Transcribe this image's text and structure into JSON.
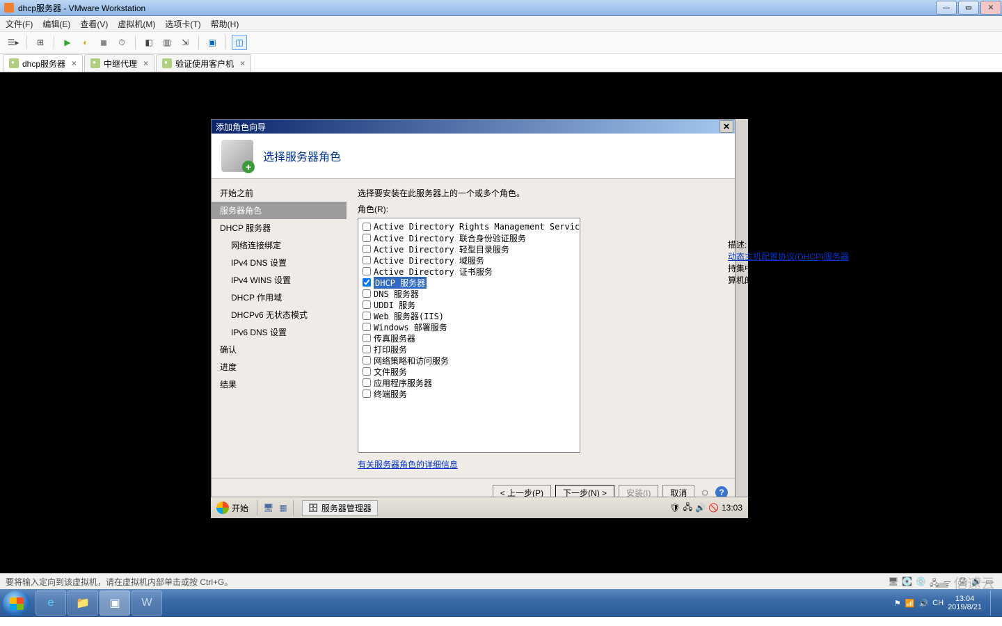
{
  "win7": {
    "title": "dhcp服务器 - VMware Workstation",
    "tray": {
      "time": "13:04",
      "date": "2019/8/21",
      "lang": "CH"
    }
  },
  "vmware": {
    "menu": [
      "文件(F)",
      "编辑(E)",
      "查看(V)",
      "虚拟机(M)",
      "选项卡(T)",
      "帮助(H)"
    ],
    "tabs": [
      {
        "label": "dhcp服务器",
        "active": true
      },
      {
        "label": "中继代理",
        "active": false
      },
      {
        "label": "验证使用客户机",
        "active": false
      }
    ],
    "status": "要将输入定向到该虚拟机，请在虚拟机内部单击或按 Ctrl+G。"
  },
  "wizard": {
    "title": "添加角色向导",
    "heading": "选择服务器角色",
    "nav": [
      {
        "label": "开始之前",
        "sub": false,
        "active": false
      },
      {
        "label": "服务器角色",
        "sub": false,
        "active": true
      },
      {
        "label": "DHCP 服务器",
        "sub": false,
        "active": false
      },
      {
        "label": "网络连接绑定",
        "sub": true,
        "active": false
      },
      {
        "label": "IPv4 DNS 设置",
        "sub": true,
        "active": false
      },
      {
        "label": "IPv4 WINS 设置",
        "sub": true,
        "active": false
      },
      {
        "label": "DHCP 作用域",
        "sub": true,
        "active": false
      },
      {
        "label": "DHCPv6 无状态模式",
        "sub": true,
        "active": false
      },
      {
        "label": "IPv6 DNS 设置",
        "sub": true,
        "active": false
      },
      {
        "label": "确认",
        "sub": false,
        "active": false
      },
      {
        "label": "进度",
        "sub": false,
        "active": false
      },
      {
        "label": "结果",
        "sub": false,
        "active": false
      }
    ],
    "prompt": "选择要安装在此服务器上的一个或多个角色。",
    "roles_label": "角色(R):",
    "roles": [
      {
        "label": "Active Directory Rights Management Services",
        "checked": false,
        "selected": false
      },
      {
        "label": "Active Directory 联合身份验证服务",
        "checked": false,
        "selected": false
      },
      {
        "label": "Active Directory 轻型目录服务",
        "checked": false,
        "selected": false
      },
      {
        "label": "Active Directory 域服务",
        "checked": false,
        "selected": false
      },
      {
        "label": "Active Directory 证书服务",
        "checked": false,
        "selected": false
      },
      {
        "label": "DHCP 服务器",
        "checked": true,
        "selected": true
      },
      {
        "label": "DNS 服务器",
        "checked": false,
        "selected": false
      },
      {
        "label": "UDDI 服务",
        "checked": false,
        "selected": false
      },
      {
        "label": "Web 服务器(IIS)",
        "checked": false,
        "selected": false
      },
      {
        "label": "Windows 部署服务",
        "checked": false,
        "selected": false
      },
      {
        "label": "传真服务器",
        "checked": false,
        "selected": false
      },
      {
        "label": "打印服务",
        "checked": false,
        "selected": false
      },
      {
        "label": "网络策略和访问服务",
        "checked": false,
        "selected": false
      },
      {
        "label": "文件服务",
        "checked": false,
        "selected": false
      },
      {
        "label": "应用程序服务器",
        "checked": false,
        "selected": false
      },
      {
        "label": "终端服务",
        "checked": false,
        "selected": false
      }
    ],
    "desc_label": "描述:",
    "desc_link": "动态主机配置协议(DHCP)服务器",
    "desc_text": "支持集中配置、管理和提供客户端计算机的临时 IP 地址和相关信息。",
    "more_link": "有关服务器角色的详细信息",
    "buttons": {
      "prev": "< 上一步(P)",
      "next": "下一步(N) >",
      "install": "安装(I)",
      "cancel": "取消"
    }
  },
  "guest_taskbar": {
    "start": "开始",
    "task": "服务器管理器",
    "time": "13:03"
  },
  "watermark": "亿速云"
}
